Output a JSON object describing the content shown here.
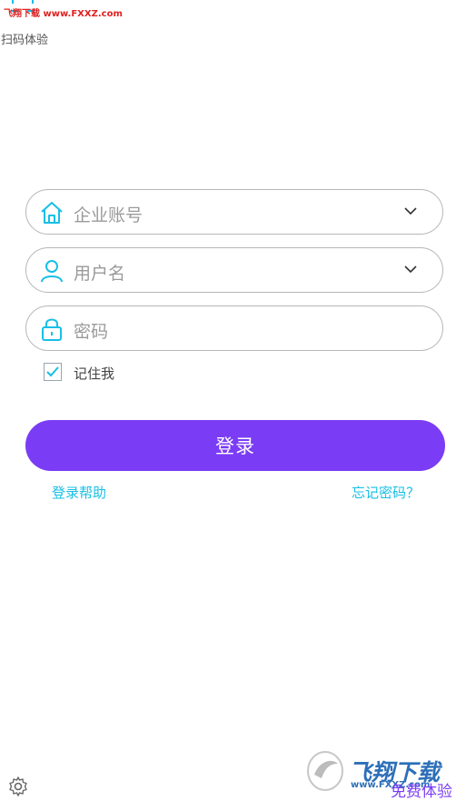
{
  "watermark_top": "飞翔下载 www.FXXZ.com",
  "scan": {
    "label": "扫码体验",
    "icon": "scan-icon"
  },
  "logo": {
    "icon": "brand-bars-logo"
  },
  "form": {
    "company": {
      "placeholder": "企业账号",
      "icon": "home-icon"
    },
    "username": {
      "placeholder": "用户名",
      "icon": "user-icon"
    },
    "password": {
      "placeholder": "密码",
      "icon": "lock-icon"
    },
    "remember": {
      "label": "记住我",
      "checked": true
    }
  },
  "login_button": "登录",
  "links": {
    "help": "登录帮助",
    "forgot": "忘记密码？"
  },
  "settings_icon": "gear-icon",
  "watermark_bottom": {
    "brand": "飞翔下载",
    "url": "www.FXXZ.com",
    "free": "免费体验"
  },
  "colors": {
    "primary": "#7b3cf5",
    "accent": "#17bfe6",
    "border": "#b7b7b7"
  }
}
